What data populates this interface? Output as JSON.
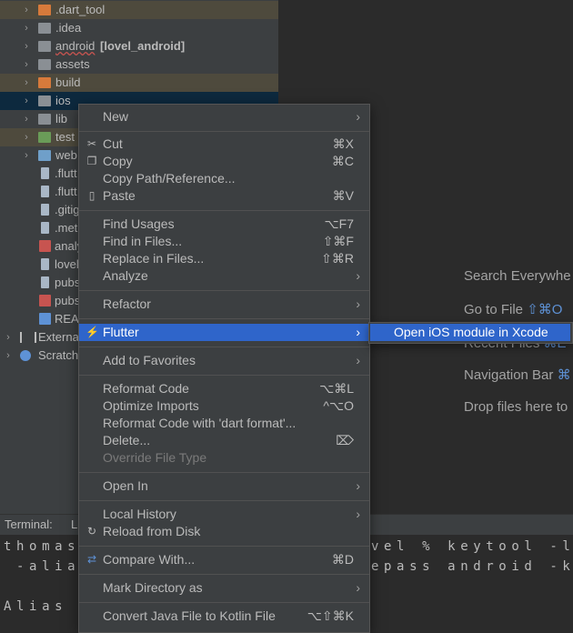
{
  "project_tree": {
    "rows": [
      {
        "label": ".dart_tool",
        "icon": "folder-icon",
        "state": "build"
      },
      {
        "label": ".idea",
        "icon": "folder-icon",
        "state": ""
      },
      {
        "label": "android",
        "suffix": "[lovel_android]",
        "icon": "android-module-folder-icon",
        "state": ""
      },
      {
        "label": "assets",
        "icon": "folder-icon",
        "state": ""
      },
      {
        "label": "build",
        "icon": "excluded-folder-icon",
        "state": "build"
      },
      {
        "label": "ios",
        "icon": "folder-icon",
        "state": "selected"
      },
      {
        "label": "lib",
        "icon": "folder-icon",
        "state": ""
      },
      {
        "label": "test",
        "icon": "test-folder-icon",
        "state": "build"
      },
      {
        "label": "web",
        "icon": "web-folder-icon",
        "state": ""
      },
      {
        "label": ".flutt",
        "icon": "file-icon",
        "state": ""
      },
      {
        "label": ".flutt",
        "icon": "file-icon",
        "state": ""
      },
      {
        "label": ".gitig",
        "icon": "file-icon",
        "state": ""
      },
      {
        "label": ".met",
        "icon": "file-icon",
        "state": ""
      },
      {
        "label": "analy",
        "icon": "yaml-file-icon",
        "state": ""
      },
      {
        "label": "lovel",
        "icon": "file-icon",
        "state": ""
      },
      {
        "label": "pubs",
        "icon": "file-icon",
        "state": ""
      },
      {
        "label": "pubs",
        "icon": "yaml-file-icon",
        "state": ""
      },
      {
        "label": "REA",
        "icon": "markdown-file-icon",
        "state": ""
      },
      {
        "label": "Externa",
        "icon": "libraries-icon",
        "state": ""
      },
      {
        "label": "Scratch",
        "icon": "scratches-icon",
        "state": ""
      }
    ]
  },
  "editor_hints": {
    "search_everywhere": "Search Everywhe",
    "go_to_file": "Go to File",
    "go_to_file_key": "⇧⌘O",
    "recent_files": "Recent Files",
    "recent_files_key": "⌘E",
    "navigation_bar": "Navigation Bar",
    "navigation_bar_key": "⌘",
    "drop_files": "Drop files here to"
  },
  "terminal": {
    "title": "Terminal:",
    "tab": "L",
    "lines": [
      "thomas",
      " -alia",
      "",
      "Alias"
    ],
    "lines_right": [
      "vel % keytool -l",
      "epass android -k"
    ]
  },
  "context_menu": {
    "items": [
      {
        "label": "New",
        "shortcut": "",
        "submenu": true,
        "icon": ""
      },
      {
        "label": "Cut",
        "shortcut": "⌘X",
        "submenu": false,
        "icon": "scissors-icon"
      },
      {
        "label": "Copy",
        "shortcut": "⌘C",
        "submenu": false,
        "icon": "copy-icon"
      },
      {
        "label": "Copy Path/Reference...",
        "shortcut": "",
        "submenu": false,
        "icon": ""
      },
      {
        "label": "Paste",
        "shortcut": "⌘V",
        "submenu": false,
        "icon": "paste-icon"
      },
      {
        "label": "Find Usages",
        "shortcut": "⌥F7",
        "submenu": false,
        "icon": ""
      },
      {
        "label": "Find in Files...",
        "shortcut": "⇧⌘F",
        "submenu": false,
        "icon": ""
      },
      {
        "label": "Replace in Files...",
        "shortcut": "⇧⌘R",
        "submenu": false,
        "icon": ""
      },
      {
        "label": "Analyze",
        "shortcut": "",
        "submenu": true,
        "icon": ""
      },
      {
        "label": "Refactor",
        "shortcut": "",
        "submenu": true,
        "icon": ""
      },
      {
        "label": "Flutter",
        "shortcut": "",
        "submenu": true,
        "icon": "flutter-icon"
      },
      {
        "label": "Add to Favorites",
        "shortcut": "",
        "submenu": true,
        "icon": ""
      },
      {
        "label": "Reformat Code",
        "shortcut": "⌥⌘L",
        "submenu": false,
        "icon": ""
      },
      {
        "label": "Optimize Imports",
        "shortcut": "^⌥O",
        "submenu": false,
        "icon": ""
      },
      {
        "label": "Reformat Code with 'dart format'...",
        "shortcut": "",
        "submenu": false,
        "icon": ""
      },
      {
        "label": "Delete...",
        "shortcut": "⌦",
        "submenu": false,
        "icon": ""
      },
      {
        "label": "Override File Type",
        "shortcut": "",
        "submenu": false,
        "icon": "",
        "disabled": true
      },
      {
        "label": "Open In",
        "shortcut": "",
        "submenu": true,
        "icon": ""
      },
      {
        "label": "Local History",
        "shortcut": "",
        "submenu": true,
        "icon": ""
      },
      {
        "label": "Reload from Disk",
        "shortcut": "",
        "submenu": false,
        "icon": "reload-icon"
      },
      {
        "label": "Compare With...",
        "shortcut": "⌘D",
        "submenu": false,
        "icon": "compare-icon"
      },
      {
        "label": "Mark Directory as",
        "shortcut": "",
        "submenu": true,
        "icon": ""
      },
      {
        "label": "Convert Java File to Kotlin File",
        "shortcut": "⌥⇧⌘K",
        "submenu": false,
        "icon": ""
      }
    ]
  },
  "flutter_submenu": {
    "item": "Open iOS module in Xcode"
  }
}
